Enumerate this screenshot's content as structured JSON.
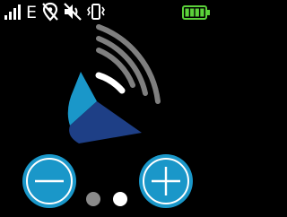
{
  "status_bar": {
    "network_type": "E",
    "icons": [
      "signal-strength-icon",
      "location-off-icon",
      "sound-muted-icon",
      "vibrate-icon",
      "battery-icon"
    ],
    "battery_level": 1.0,
    "battery_color": "#5bd23a"
  },
  "main": {
    "icon": "volume-up-icon",
    "accent_color": "#1a97c9",
    "dark_accent_color": "#1e3f86",
    "wave_color": "#7f7f7f"
  },
  "controls": {
    "decrease_icon": "minus-icon",
    "increase_icon": "plus-icon",
    "button_color": "#1a97c9"
  },
  "pager": {
    "page_count": 2,
    "current_page": 2,
    "inactive_color": "#8a8a8a",
    "active_color": "#ffffff"
  }
}
